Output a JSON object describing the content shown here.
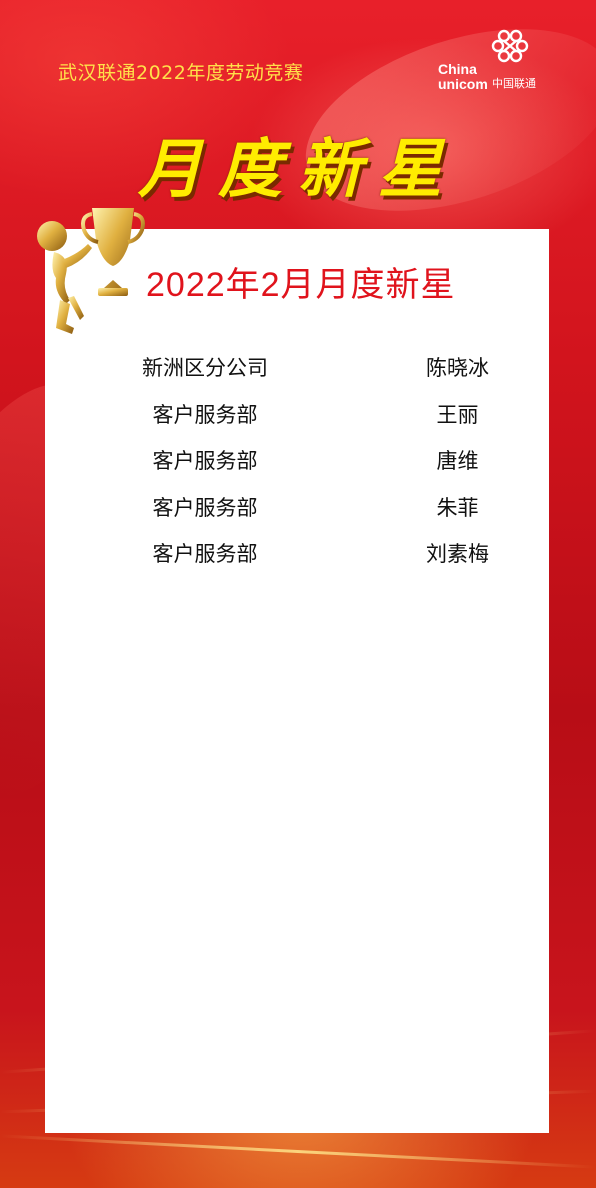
{
  "header": {
    "subtitle": "武汉联通2022年度劳动竞赛",
    "title": "月度新星",
    "logo": {
      "en_line1": "China",
      "en_line2": "unicom",
      "cn": "中国联通",
      "icon": "china-unicom-knot-icon",
      "color": "#ffffff"
    }
  },
  "card": {
    "title": "2022年2月月度新星",
    "title_color": "#e0131c",
    "decoration_icon": "golden-figure-trophy-icon"
  },
  "winners": [
    {
      "dept": "新洲区分公司",
      "name": "陈晓冰"
    },
    {
      "dept": "客户服务部",
      "name": "王丽"
    },
    {
      "dept": "客户服务部",
      "name": "唐维"
    },
    {
      "dept": "客户服务部",
      "name": "朱菲"
    },
    {
      "dept": "客户服务部",
      "name": "刘素梅"
    }
  ],
  "colors": {
    "background_red": "#d2141d",
    "title_yellow": "#ffec00",
    "subtitle_yellow": "#ffe14a"
  }
}
